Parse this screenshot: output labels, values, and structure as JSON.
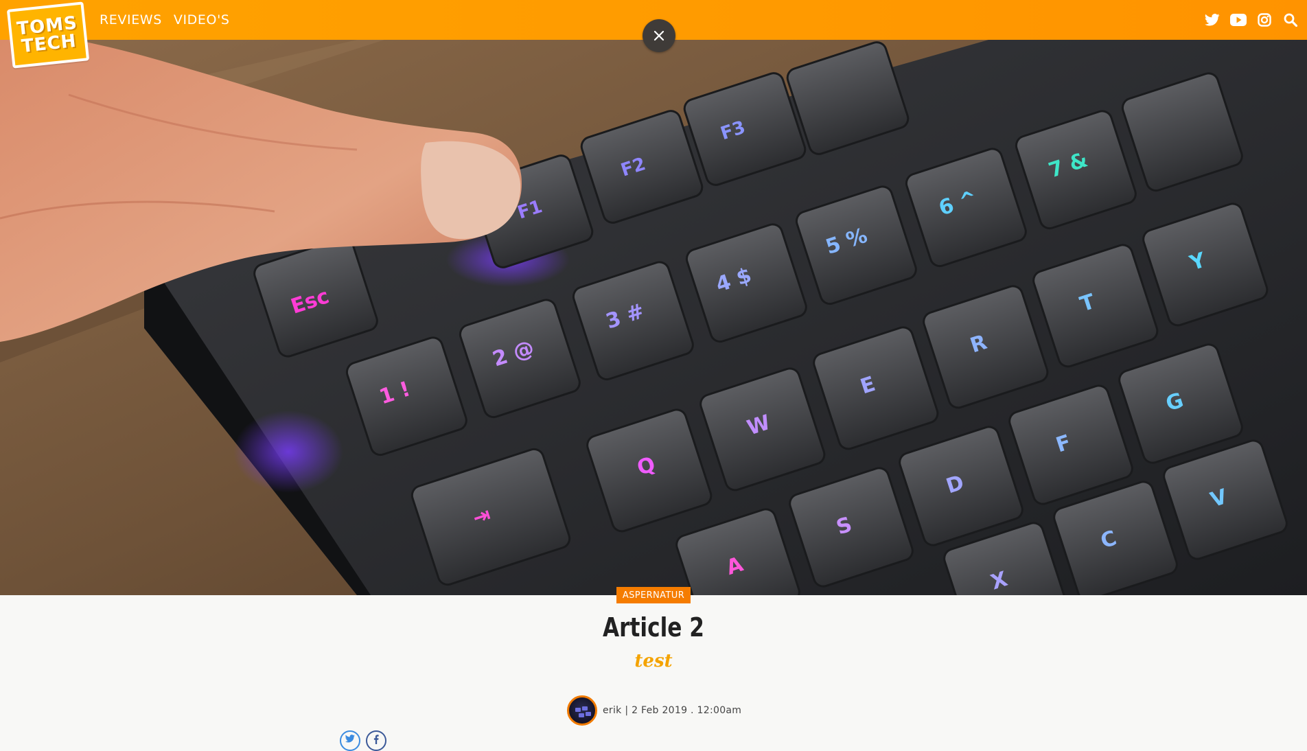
{
  "header": {
    "logo_line1": "TOMS",
    "logo_line2": "TECH",
    "nav": [
      "REVIEWS",
      "VIDEO'S"
    ],
    "social_icons": [
      "twitter-icon",
      "youtube-icon",
      "instagram-icon",
      "search-icon"
    ],
    "accent": "#ff9d00"
  },
  "hero": {
    "description_icon": "keyboard-photo"
  },
  "article": {
    "category": "ASPERNATUR",
    "title": "Article 2",
    "subtitle": "test",
    "author": "erik",
    "date": "2 Feb 2019",
    "time": "12:00am",
    "byline": "erik | 2 Feb 2019 . 12:00am",
    "category_color": "#f57c00",
    "subtitle_color": "#f4a300"
  }
}
